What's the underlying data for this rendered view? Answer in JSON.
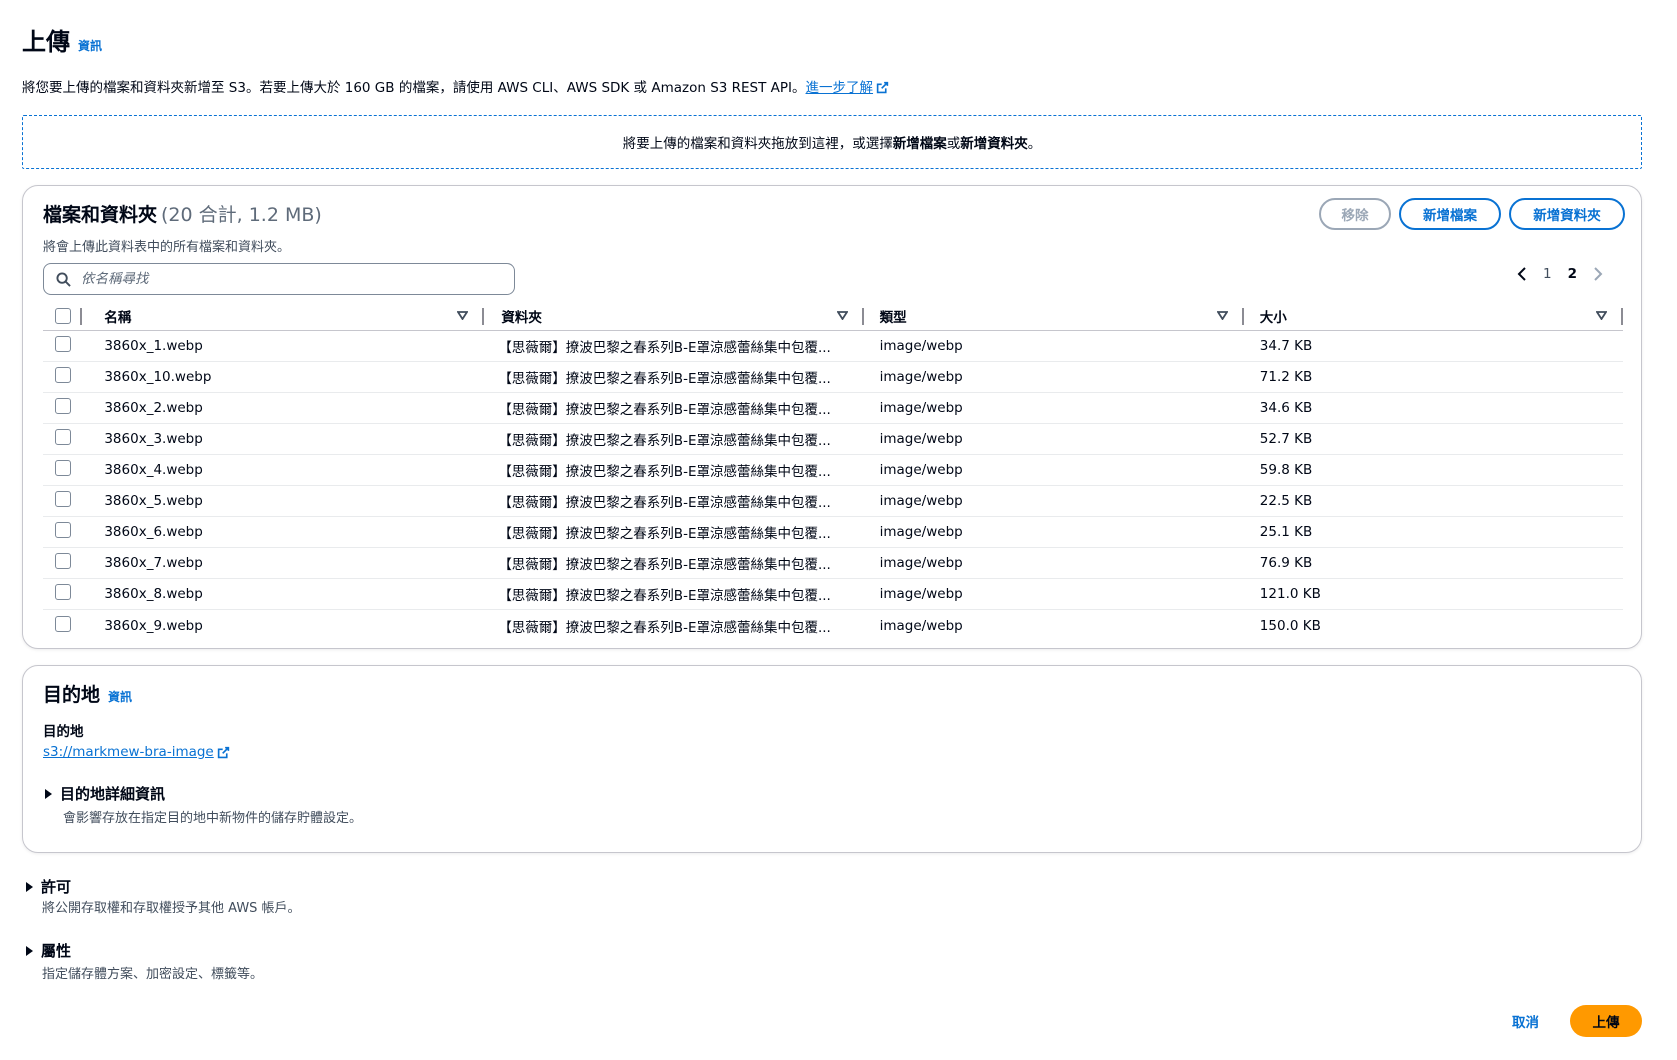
{
  "header": {
    "title": "上傳",
    "info_label": "資訊",
    "description": "將您要上傳的檔案和資料夾新增至 S3。若要上傳大於 160 GB 的檔案，請使用 AWS CLI、AWS SDK 或 Amazon S3 REST API。",
    "learn_more": "進一步了解"
  },
  "dropzone": {
    "text_before": "將要上傳的檔案和資料夾拖放到這裡，或選擇",
    "add_files": "新增檔案",
    "or": "或",
    "add_folder": "新增資料夾",
    "text_after": "。"
  },
  "files_panel": {
    "title": "檔案和資料夾",
    "count": "(20 合計, 1.2 MB)",
    "subtitle": "將會上傳此資料表中的所有檔案和資料夾。",
    "remove_button": "移除",
    "add_files_button": "新增檔案",
    "add_folder_button": "新增資料夾",
    "search_placeholder": "依名稱尋找",
    "pagination": {
      "pages": [
        "1",
        "2"
      ],
      "current": "2"
    },
    "columns": [
      "名稱",
      "資料夾",
      "類型",
      "大小"
    ],
    "rows": [
      {
        "name": "3860x_1.webp",
        "folder": "【思薇爾】撩波巴黎之春系列B-E罩涼感蕾絲集中包覆...",
        "type": "image/webp",
        "size": "34.7 KB"
      },
      {
        "name": "3860x_10.webp",
        "folder": "【思薇爾】撩波巴黎之春系列B-E罩涼感蕾絲集中包覆...",
        "type": "image/webp",
        "size": "71.2 KB"
      },
      {
        "name": "3860x_2.webp",
        "folder": "【思薇爾】撩波巴黎之春系列B-E罩涼感蕾絲集中包覆...",
        "type": "image/webp",
        "size": "34.6 KB"
      },
      {
        "name": "3860x_3.webp",
        "folder": "【思薇爾】撩波巴黎之春系列B-E罩涼感蕾絲集中包覆...",
        "type": "image/webp",
        "size": "52.7 KB"
      },
      {
        "name": "3860x_4.webp",
        "folder": "【思薇爾】撩波巴黎之春系列B-E罩涼感蕾絲集中包覆...",
        "type": "image/webp",
        "size": "59.8 KB"
      },
      {
        "name": "3860x_5.webp",
        "folder": "【思薇爾】撩波巴黎之春系列B-E罩涼感蕾絲集中包覆...",
        "type": "image/webp",
        "size": "22.5 KB"
      },
      {
        "name": "3860x_6.webp",
        "folder": "【思薇爾】撩波巴黎之春系列B-E罩涼感蕾絲集中包覆...",
        "type": "image/webp",
        "size": "25.1 KB"
      },
      {
        "name": "3860x_7.webp",
        "folder": "【思薇爾】撩波巴黎之春系列B-E罩涼感蕾絲集中包覆...",
        "type": "image/webp",
        "size": "76.9 KB"
      },
      {
        "name": "3860x_8.webp",
        "folder": "【思薇爾】撩波巴黎之春系列B-E罩涼感蕾絲集中包覆...",
        "type": "image/webp",
        "size": "121.0 KB"
      },
      {
        "name": "3860x_9.webp",
        "folder": "【思薇爾】撩波巴黎之春系列B-E罩涼感蕾絲集中包覆...",
        "type": "image/webp",
        "size": "150.0 KB"
      }
    ]
  },
  "destination": {
    "title": "目的地",
    "info_label": "資訊",
    "label": "目的地",
    "link": "s3://markmew-bra-image",
    "details_title": "目的地詳細資訊",
    "details_desc": "會影響存放在指定目的地中新物件的儲存貯體設定。"
  },
  "permissions": {
    "title": "許可",
    "desc": "將公開存取權和存取權授予其他 AWS 帳戶。"
  },
  "properties": {
    "title": "屬性",
    "desc": "指定儲存體方案、加密設定、標籤等。"
  },
  "footer": {
    "cancel": "取消",
    "upload": "上傳"
  },
  "colors": {
    "link": "#0972d3",
    "primary_button": "#ff9900",
    "disabled": "#9ba7b6",
    "border": "#c6c6cd"
  }
}
